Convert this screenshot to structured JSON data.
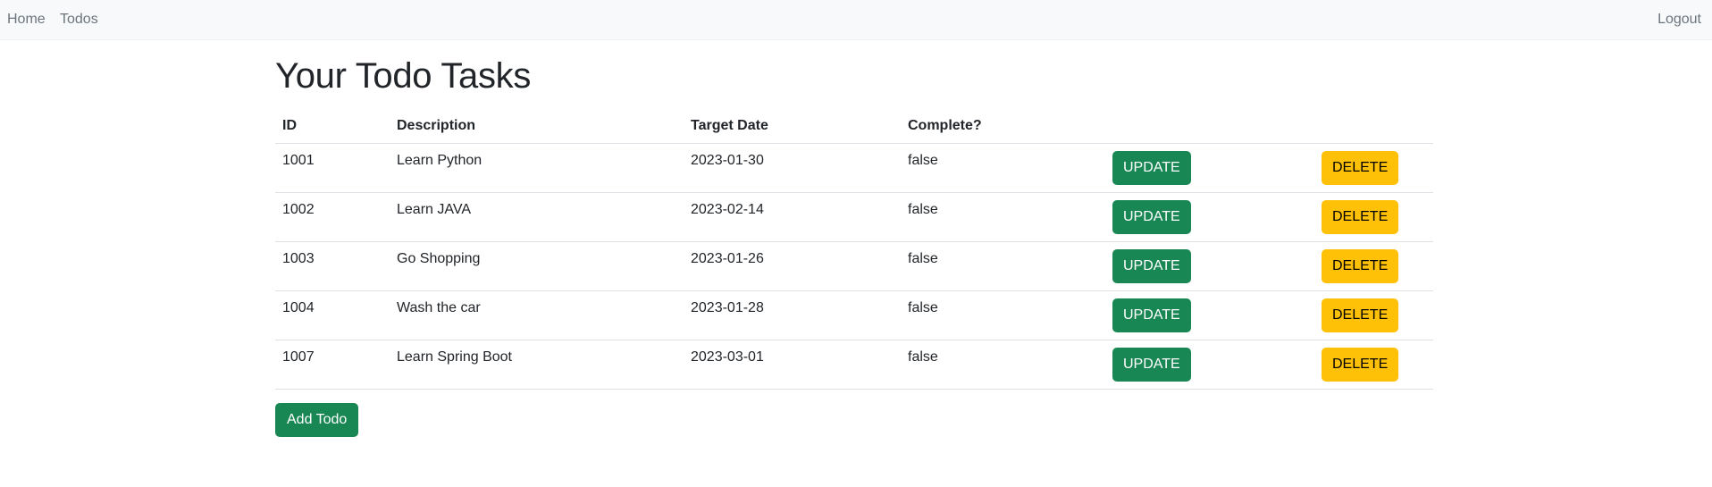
{
  "nav": {
    "home": "Home",
    "todos": "Todos",
    "logout": "Logout"
  },
  "page_title": "Your Todo Tasks",
  "table": {
    "headers": [
      "ID",
      "Description",
      "Target Date",
      "Complete?",
      "",
      ""
    ],
    "rows": [
      {
        "id": "1001",
        "description": "Learn Python",
        "target_date": "2023-01-30",
        "complete": "false",
        "update_label": "UPDATE",
        "delete_label": "DELETE"
      },
      {
        "id": "1002",
        "description": "Learn JAVA",
        "target_date": "2023-02-14",
        "complete": "false",
        "update_label": "UPDATE",
        "delete_label": "DELETE"
      },
      {
        "id": "1003",
        "description": "Go Shopping",
        "target_date": "2023-01-26",
        "complete": "false",
        "update_label": "UPDATE",
        "delete_label": "DELETE"
      },
      {
        "id": "1004",
        "description": "Wash the car",
        "target_date": "2023-01-28",
        "complete": "false",
        "update_label": "UPDATE",
        "delete_label": "DELETE"
      },
      {
        "id": "1007",
        "description": "Learn Spring Boot",
        "target_date": "2023-03-01",
        "complete": "false",
        "update_label": "UPDATE",
        "delete_label": "DELETE"
      }
    ]
  },
  "add_button": "Add Todo",
  "colors": {
    "navbar_bg": "#f8f9fa",
    "success": "#198754",
    "warning": "#ffc107",
    "text": "#212529",
    "muted": "#6c757d"
  }
}
